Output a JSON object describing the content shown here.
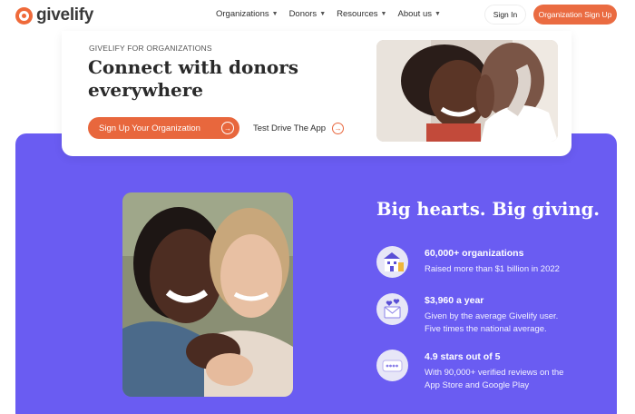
{
  "nav": {
    "logo_text": "givelify",
    "menu": [
      {
        "label": "Organizations"
      },
      {
        "label": "Donors"
      },
      {
        "label": "Resources"
      },
      {
        "label": "About us"
      }
    ],
    "signin_label": "Sign In",
    "signup_label": "Organization Sign Up"
  },
  "hero": {
    "eyebrow": "GIVELIFY FOR ORGANIZATIONS",
    "headline": "Connect with donors everywhere",
    "primary_cta": "Sign Up Your Organization",
    "secondary_cta": "Test Drive The App"
  },
  "stats_section": {
    "title": "Big hearts. Big giving.",
    "items": [
      {
        "icon": "building-icon",
        "title": "60,000+ organizations",
        "desc": "Raised more than $1 billion in 2022"
      },
      {
        "icon": "envelope-hearts-icon",
        "title": "$3,960 a year",
        "desc": "Given by the average Givelify user. Five times the national average."
      },
      {
        "icon": "rating-stars-icon",
        "title": "4.9 stars out of 5",
        "desc": "With 90,000+ verified reviews on the App Store and Google Play"
      }
    ]
  },
  "colors": {
    "brand_orange": "#e8673d",
    "panel_purple": "#6a5cf2"
  }
}
